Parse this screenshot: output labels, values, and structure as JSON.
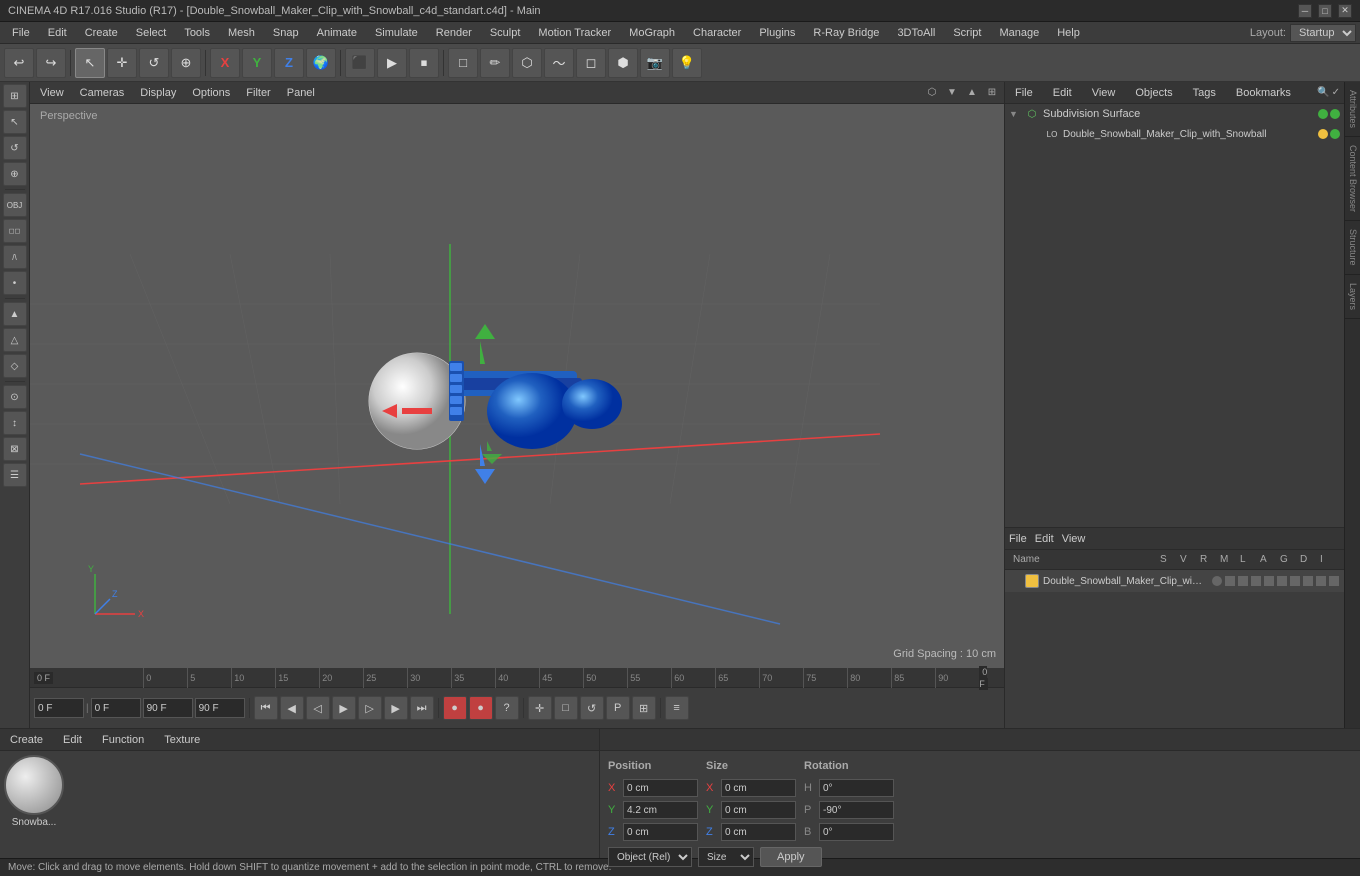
{
  "titlebar": {
    "title": "CINEMA 4D R17.016 Studio (R17) - [Double_Snowball_Maker_Clip_with_Snowball_c4d_standart.c4d] - Main",
    "minimize": "─",
    "restore": "□",
    "close": "✕"
  },
  "menubar": {
    "items": [
      "File",
      "Edit",
      "Create",
      "Select",
      "Tools",
      "Mesh",
      "Snap",
      "Animate",
      "Simulate",
      "Render",
      "Sculpt",
      "Motion Tracker",
      "MoGraph",
      "Character",
      "Plugins",
      "R-Ray Bridge",
      "3DToAll",
      "Script",
      "Manage",
      "Plugins",
      "Help"
    ],
    "layout_label": "Layout:",
    "layout_value": "Startup"
  },
  "toolbar": {
    "undo": "↩",
    "tools": [
      "↖",
      "✛",
      "□",
      "↻",
      "✦",
      "←",
      "→",
      "↑",
      "⬜",
      "🔵",
      "🔷",
      "🔹",
      "⬡",
      "⬢",
      "▼",
      "🌐",
      "💡"
    ]
  },
  "viewport": {
    "menus": [
      "View",
      "Cameras",
      "Display",
      "Options",
      "Filter",
      "Panel"
    ],
    "label": "Perspective",
    "grid_spacing": "Grid Spacing : 10 cm"
  },
  "timeline": {
    "frame_start": "0 F",
    "frame_end": "90 F",
    "current": "0 F",
    "preview_start": "0 F",
    "preview_end": "90 F",
    "marks": [
      "0",
      "5",
      "10",
      "15",
      "20",
      "25",
      "30",
      "35",
      "40",
      "45",
      "50",
      "55",
      "60",
      "65",
      "70",
      "75",
      "80",
      "85",
      "90"
    ]
  },
  "object_tree": {
    "header_menus": [
      "File",
      "Edit",
      "View",
      "Objects",
      "Tags",
      "Bookmarks"
    ],
    "items": [
      {
        "name": "Subdivision Surface",
        "level": 0,
        "type": "subdiv",
        "selected": false
      },
      {
        "name": "Double_Snowball_Maker_Clip_with_Snowball",
        "level": 1,
        "type": "object",
        "selected": false
      }
    ]
  },
  "object_list": {
    "header_menus": [
      "File",
      "Edit",
      "View"
    ],
    "columns": [
      "Name",
      "S",
      "V",
      "R",
      "M",
      "L",
      "A",
      "G",
      "D",
      "I"
    ],
    "items": [
      {
        "name": "Double_Snowball_Maker_Clip_with_Snowball",
        "icon_color": "#f0c040",
        "selected": true
      }
    ]
  },
  "properties": {
    "section_label": "Position",
    "size_label": "Size",
    "rotation_label": "Rotation",
    "x_pos": "0 cm",
    "y_pos": "4.2 cm",
    "z_pos": "0 cm",
    "x_size": "0 cm",
    "y_size": "0 cm",
    "z_size": "0 cm",
    "h_rot": "0°",
    "p_rot": "-90°",
    "b_rot": "0°",
    "coord_system": "Object (Rel)",
    "size_mode": "Size",
    "apply_label": "Apply"
  },
  "material": {
    "menus": [
      "Create",
      "Edit",
      "Function",
      "Texture"
    ],
    "name": "Snowba..."
  },
  "left_tools": [
    "⊞",
    "⬟",
    "↺",
    "⊕",
    "←",
    "→",
    "↑",
    "",
    "▲",
    "△",
    "◇",
    "◻",
    "⊙",
    "↕",
    "▥",
    "⊠",
    "☰"
  ],
  "statusbar": {
    "message": "Move: Click and drag to move elements. Hold down SHIFT to quantize movement + add to the selection in point mode, CTRL to remove."
  },
  "right_edge_tabs": [
    "Attributes",
    "Content Browser",
    "Structure",
    "Layers"
  ]
}
